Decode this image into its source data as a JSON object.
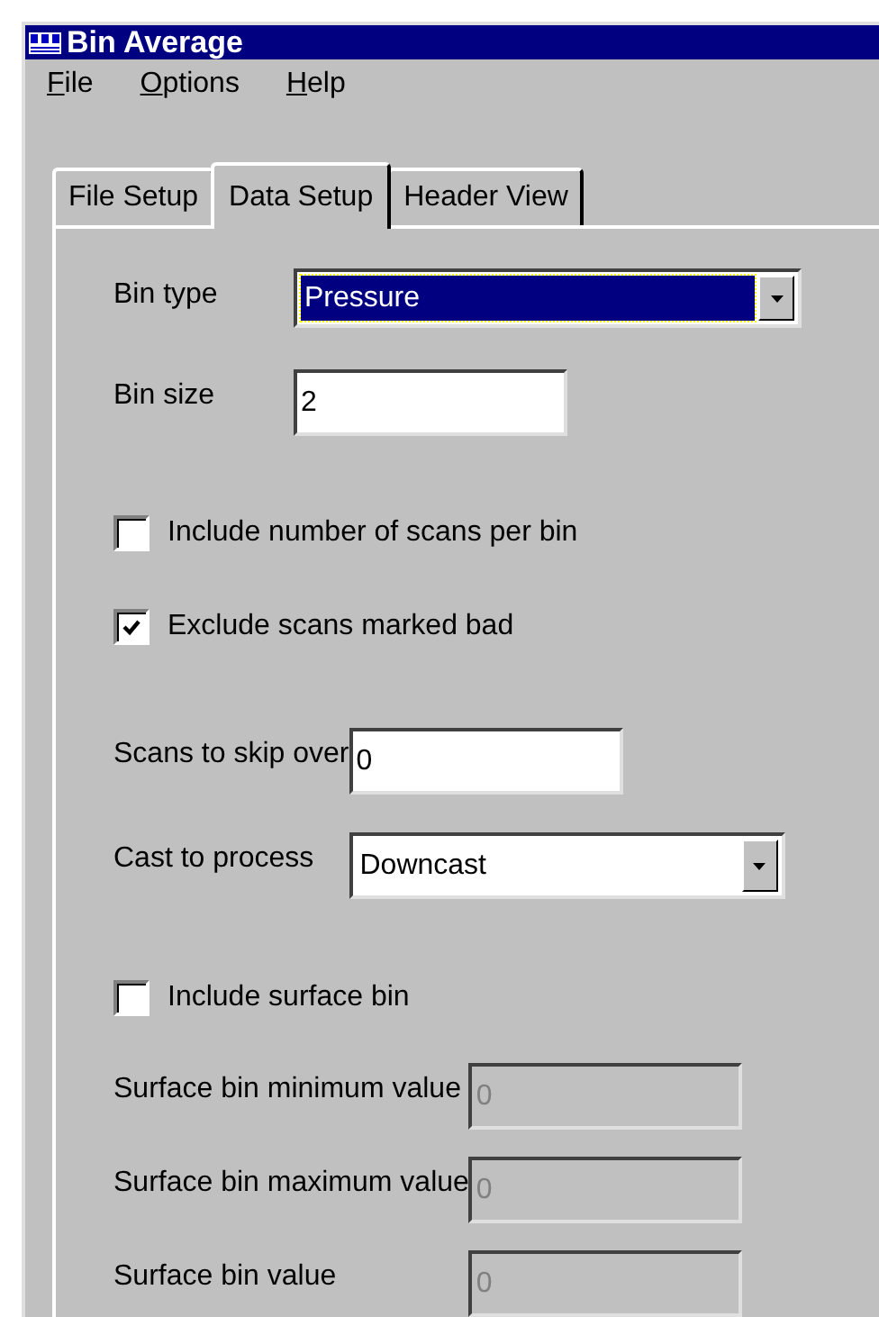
{
  "window": {
    "title": "Bin Average"
  },
  "menu": [
    {
      "label": "File"
    },
    {
      "label": "Options"
    },
    {
      "label": "Help"
    }
  ],
  "tabs": [
    {
      "label": "File Setup",
      "selected": false
    },
    {
      "label": "Data Setup",
      "selected": true
    },
    {
      "label": "Header View",
      "selected": false
    }
  ],
  "sections": [
    [
      {
        "kind": "dropdown",
        "label": "Bin type",
        "value": "Pressure",
        "focused": true,
        "disabled": false
      },
      {
        "kind": "text",
        "label": "Bin size",
        "value": "2",
        "disabled": false
      }
    ],
    [
      {
        "kind": "checkbox",
        "label": "Include number of scans per bin",
        "checked": false
      },
      {
        "kind": "checkbox",
        "label": "Exclude scans marked bad",
        "checked": true
      }
    ],
    [
      {
        "kind": "text",
        "label": "Scans to skip over",
        "value": "0",
        "disabled": false
      },
      {
        "kind": "dropdown",
        "label": "Cast to process",
        "value": "Downcast",
        "focused": false,
        "disabled": false
      }
    ],
    [
      {
        "kind": "checkbox",
        "label": "Include surface bin",
        "checked": false
      }
    ],
    [
      {
        "kind": "text",
        "label": "Surface bin minimum value",
        "value": "0",
        "disabled": true
      },
      {
        "kind": "text",
        "label": "Surface bin maximum value",
        "value": "0",
        "disabled": true
      },
      {
        "kind": "text",
        "label": "Surface bin value",
        "value": "0",
        "disabled": true
      }
    ]
  ]
}
